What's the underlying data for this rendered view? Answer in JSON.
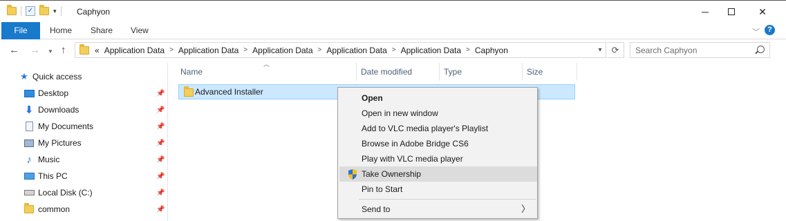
{
  "window": {
    "title": "Caphyon",
    "qat_down": "▾"
  },
  "ribbon": {
    "tabs": [
      "File",
      "Home",
      "Share",
      "View"
    ],
    "help": "?"
  },
  "address": {
    "prefix": "«",
    "crumbs": [
      "Application Data",
      "Application Data",
      "Application Data",
      "Application Data",
      "Application Data",
      "Caphyon"
    ]
  },
  "search": {
    "placeholder": "Search Caphyon"
  },
  "nav": {
    "quick_access": "Quick access",
    "items": [
      {
        "label": "Desktop",
        "icon": "desktop-icon"
      },
      {
        "label": "Downloads",
        "icon": "download-icon"
      },
      {
        "label": "My Documents",
        "icon": "documents-icon"
      },
      {
        "label": "My Pictures",
        "icon": "pictures-icon"
      },
      {
        "label": "Music",
        "icon": "music-icon"
      },
      {
        "label": "This PC",
        "icon": "computer-icon"
      },
      {
        "label": "Local Disk (C:)",
        "icon": "disk-icon"
      },
      {
        "label": "common",
        "icon": "folder-icon"
      }
    ]
  },
  "columns": [
    "Name",
    "Date modified",
    "Type",
    "Size"
  ],
  "files": [
    {
      "name": "Advanced Installer",
      "selected": true
    }
  ],
  "context_menu": {
    "items": [
      "Open",
      "Open in new window",
      "Add to VLC media player's Playlist",
      "Browse in Adobe Bridge CS6",
      "Play with VLC media player",
      "Take Ownership",
      "Pin to Start",
      "Send to"
    ],
    "highlighted": "Take Ownership",
    "default": "Open"
  },
  "colors": {
    "accent": "#1979ca",
    "selection": "#cce8ff",
    "menu_bg": "#f2f2f2",
    "menu_highlight": "#dcdcdc"
  }
}
